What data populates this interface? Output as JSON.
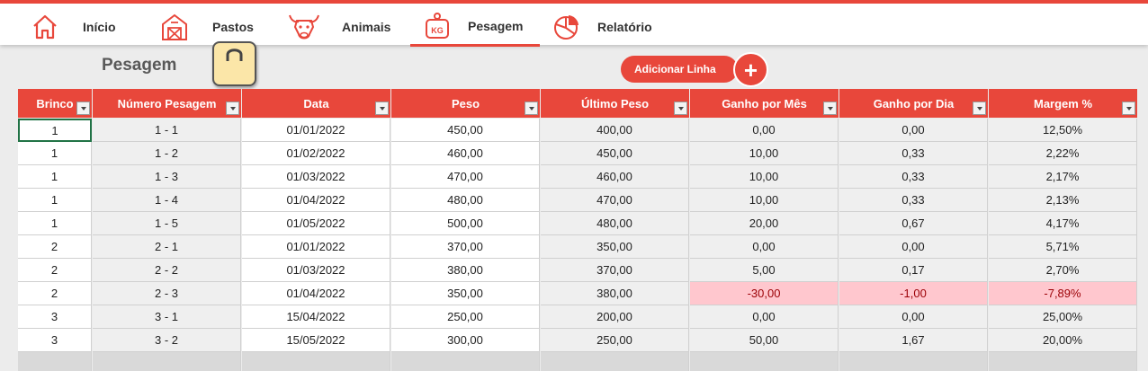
{
  "nav": {
    "items": [
      {
        "id": "inicio",
        "label": "Início",
        "icon": "home-icon"
      },
      {
        "id": "pastos",
        "label": "Pastos",
        "icon": "barn-icon"
      },
      {
        "id": "animais",
        "label": "Animais",
        "icon": "bull-icon"
      },
      {
        "id": "pesagem",
        "label": "Pesagem",
        "icon": "scale-kg-icon",
        "kg": "KG",
        "active": true
      },
      {
        "id": "relatorio",
        "label": "Relatório",
        "icon": "pie-chart-icon"
      }
    ]
  },
  "page": {
    "title": "Pesagem",
    "add_button": "Adicionar Linha",
    "add_symbol": "+"
  },
  "colors": {
    "accent": "#e8473b",
    "negative_fill": "#ffc7ce",
    "negative_text": "#9c0006"
  },
  "table": {
    "columns": [
      "Brinco",
      "Número Pesagem",
      "Data",
      "Peso",
      "Último Peso",
      "Ganho por Mês",
      "Ganho por Dia",
      "Margem %"
    ],
    "rows": [
      [
        "1",
        "1 - 1",
        "01/01/2022",
        "450,00",
        "400,00",
        "0,00",
        "0,00",
        "12,50%"
      ],
      [
        "1",
        "1 - 2",
        "01/02/2022",
        "460,00",
        "450,00",
        "10,00",
        "0,33",
        "2,22%"
      ],
      [
        "1",
        "1 - 3",
        "01/03/2022",
        "470,00",
        "460,00",
        "10,00",
        "0,33",
        "2,17%"
      ],
      [
        "1",
        "1 - 4",
        "01/04/2022",
        "480,00",
        "470,00",
        "10,00",
        "0,33",
        "2,13%"
      ],
      [
        "1",
        "1 - 5",
        "01/05/2022",
        "500,00",
        "480,00",
        "20,00",
        "0,67",
        "4,17%"
      ],
      [
        "2",
        "2 - 1",
        "01/01/2022",
        "370,00",
        "350,00",
        "0,00",
        "0,00",
        "5,71%"
      ],
      [
        "2",
        "2 - 2",
        "01/03/2022",
        "380,00",
        "370,00",
        "5,00",
        "0,17",
        "2,70%"
      ],
      [
        "2",
        "2 - 3",
        "01/04/2022",
        "350,00",
        "380,00",
        "-30,00",
        "-1,00",
        "-7,89%"
      ],
      [
        "3",
        "3 - 1",
        "15/04/2022",
        "250,00",
        "200,00",
        "0,00",
        "0,00",
        "25,00%"
      ],
      [
        "3",
        "3 - 2",
        "15/05/2022",
        "300,00",
        "250,00",
        "50,00",
        "1,67",
        "20,00%"
      ]
    ]
  }
}
